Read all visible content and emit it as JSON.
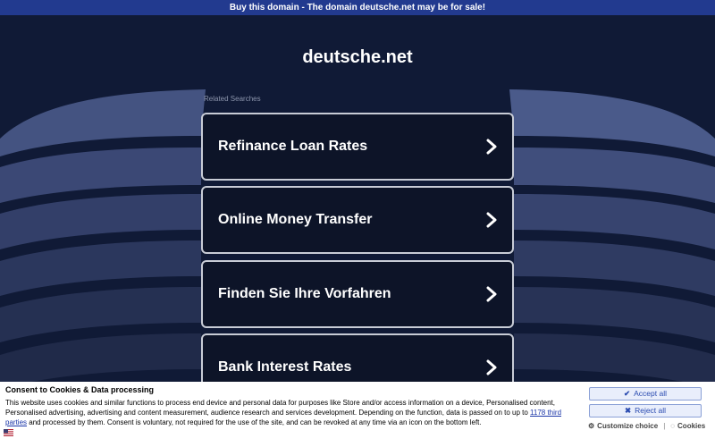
{
  "topbar": {
    "text": "Buy this domain - The domain deutsche.net may be for sale!"
  },
  "domain_title": "deutsche.net",
  "related_label": "Related Searches",
  "searches": [
    {
      "label": "Refinance Loan Rates"
    },
    {
      "label": "Online Money Transfer"
    },
    {
      "label": "Finden Sie Ihre Vorfahren"
    },
    {
      "label": "Bank Interest Rates"
    }
  ],
  "consent": {
    "title": "Consent to Cookies & Data processing",
    "text_before": "This website uses cookies and similar functions to process end device and personal data for purposes like Store and/or access information on a device, Personalised content, Personalised advertising, advertising and content measurement, audience research and services development. Depending on the function, data is passed on to up to ",
    "link_text": "1178 third parties",
    "text_after": " and processed by them. Consent is voluntary, not required for the use of the site, and can be revoked at any time via an icon on the bottom left.",
    "accept_label": "Accept all",
    "reject_label": "Reject all",
    "customize_label": "Customize choice",
    "separator": "|",
    "cookies_label": "Cookies"
  },
  "colors": {
    "accent": "#223a8f",
    "background": "#101a36",
    "link": "#1a35a8"
  },
  "icons": {
    "chevron": "chevron-right-icon",
    "flag": "us-flag-icon"
  }
}
